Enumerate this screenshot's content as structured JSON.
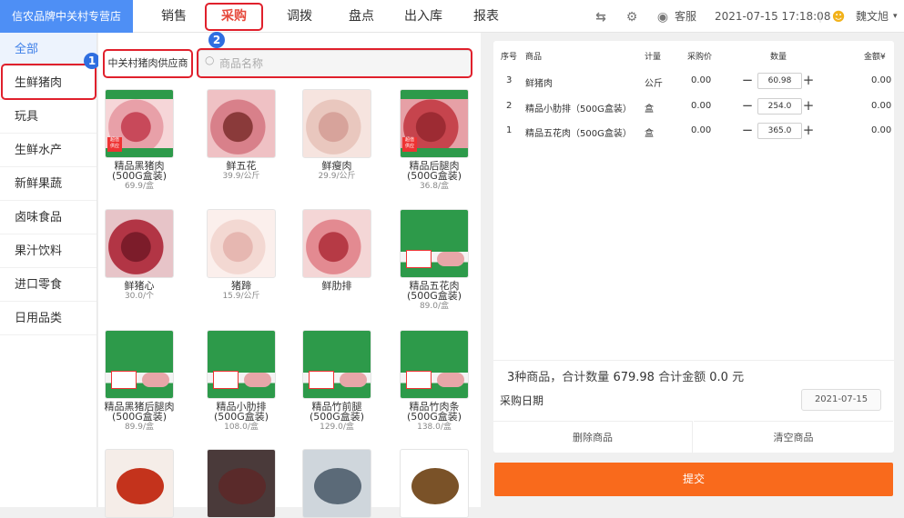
{
  "header": {
    "brand": "信农品牌中关村专营店",
    "nav": [
      "销售",
      "采购",
      "调拨",
      "盘点",
      "出入库",
      "报表"
    ],
    "service": "客服",
    "datetime": "2021-07-15 17:18:08",
    "user": "魏文旭",
    "accent": "#4e8ff5"
  },
  "annotations": {
    "step1": "1",
    "step2": "2"
  },
  "sidebar": {
    "categories": [
      "全部",
      "生鲜猪肉",
      "玩具",
      "生鲜水产",
      "新鲜果蔬",
      "卤味食品",
      "果汁饮料",
      "进口零食",
      "日用品类"
    ]
  },
  "filter": {
    "supplier": "中关村猪肉供应商",
    "search_placeholder": "商品名称"
  },
  "products": [
    {
      "name": "精品黑猪肉",
      "spec": "(500G盒装)",
      "price": "69.9/盒",
      "badge": "超值\n供应"
    },
    {
      "name": "鲜五花",
      "spec": "",
      "price": "39.9/公斤"
    },
    {
      "name": "鲜瘦肉",
      "spec": "",
      "price": "29.9/公斤"
    },
    {
      "name": "精品后腿肉",
      "spec": "(500G盒装)",
      "price": "36.8/盒",
      "badge": "超值\n供应"
    },
    {
      "name": "鲜猪心",
      "spec": "",
      "price": "30.0/个"
    },
    {
      "name": "猪蹄",
      "spec": "",
      "price": "15.9/公斤"
    },
    {
      "name": "鲜肋排",
      "spec": "",
      "price": ""
    },
    {
      "name": "精品五花肉",
      "spec": "(500G盒装)",
      "price": "89.0/盒"
    },
    {
      "name": "精品黑猪后腿肉",
      "spec": "(500G盒装)",
      "price": "89.9/盒"
    },
    {
      "name": "精品小肋排",
      "spec": "(500G盒装)",
      "price": "108.0/盒"
    },
    {
      "name": "精品竹前腿",
      "spec": "(500G盒装)",
      "price": "129.0/盒"
    },
    {
      "name": "精品竹肉条",
      "spec": "(500G盒装)",
      "price": "138.0/盒"
    },
    {
      "name": "",
      "spec": "",
      "price": ""
    },
    {
      "name": "",
      "spec": "",
      "price": ""
    },
    {
      "name": "",
      "spec": "",
      "price": ""
    },
    {
      "name": "",
      "spec": "",
      "price": ""
    }
  ],
  "cart": {
    "headers": {
      "seq": "序号",
      "product": "商品",
      "unit": "计量",
      "price": "采购价",
      "qty": "数量",
      "amount": "金额¥"
    },
    "rows": [
      {
        "seq": "3",
        "product": "鲜猪肉",
        "unit": "公斤",
        "price": "0.00",
        "qty": "60.98",
        "amount": "0.00"
      },
      {
        "seq": "2",
        "product": "精品小肋排（500G盒装）",
        "unit": "盒",
        "price": "0.00",
        "qty": "254.0",
        "amount": "0.00"
      },
      {
        "seq": "1",
        "product": "精品五花肉（500G盒装）",
        "unit": "盒",
        "price": "0.00",
        "qty": "365.0",
        "amount": "0.00"
      }
    ],
    "summary": {
      "count": "3",
      "count_label": "种商品，合计数量",
      "total_qty": "679.98",
      "total_label": "合计金额",
      "total_amount": "0.0",
      "currency": "元"
    },
    "date_label": "采购日期",
    "date_value": "2021-07-15",
    "delete_label": "删除商品",
    "clear_label": "清空商品",
    "submit_label": "提交"
  }
}
